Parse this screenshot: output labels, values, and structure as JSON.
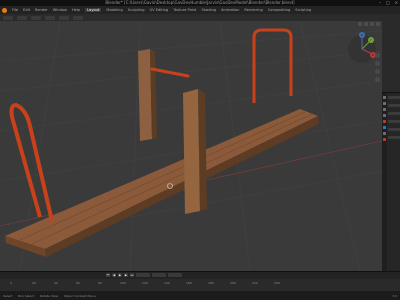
{
  "window": {
    "title": "Blender* [C:\\Users\\Gavin\\Desktop\\GavDevHumble\\Jarvis\\GavDevModel\\Blender\\Blender.blend]",
    "controls": [
      "–",
      "□",
      "×"
    ]
  },
  "menubar": {
    "items": [
      "File",
      "Edit",
      "Render",
      "Window",
      "Help",
      "Layout",
      "Modeling",
      "Sculpting",
      "UV Editing",
      "Texture Paint",
      "Shading",
      "Animation",
      "Rendering",
      "Compositing",
      "Scripting"
    ],
    "active": "Layout"
  },
  "gizmo": {
    "x": "X",
    "y": "Y",
    "z": "Z"
  },
  "timeline": {
    "start": "1",
    "end": "250",
    "frame_ticks": [
      "0",
      "20",
      "40",
      "60",
      "80",
      "100",
      "120",
      "140",
      "160",
      "180",
      "200",
      "220",
      "240"
    ]
  },
  "status": {
    "items": [
      "Select",
      "Box Select",
      "Rotate View",
      "Object Context Menu"
    ],
    "version": "3.0"
  },
  "colors": {
    "accent": "#e87d0d",
    "wood": "#8a5a3a",
    "handle": "#c8411a",
    "viewport_bg": "#3a3a3a"
  }
}
